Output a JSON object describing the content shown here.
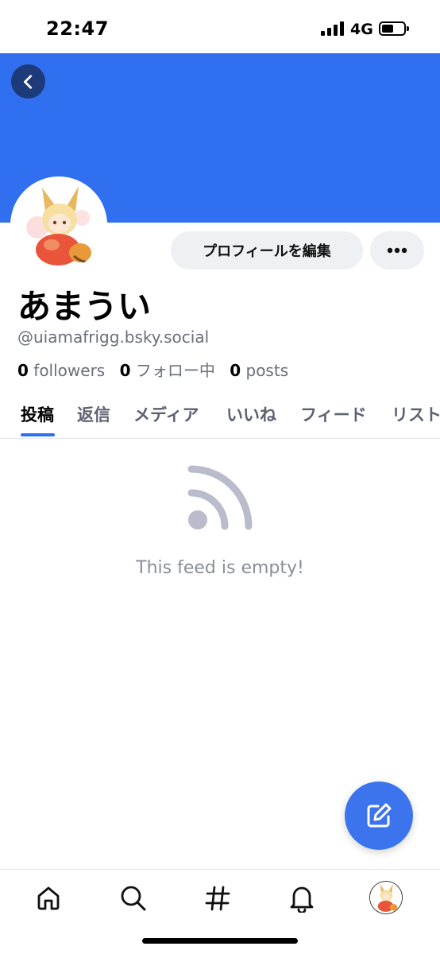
{
  "status_bar": {
    "time": "22:47",
    "network": "4G",
    "icons": [
      "signal-icon",
      "battery-icon"
    ]
  },
  "banner": {
    "color": "#3070f0",
    "back_icon": "chevron-left-icon"
  },
  "profile": {
    "avatar_icon": "fox-girl-avatar-icon",
    "edit_button_label": "プロフィールを編集",
    "more_icon": "ellipsis-icon",
    "display_name": "あまうい",
    "handle": "@uiamafrigg.bsky.social",
    "stats": {
      "followers_count": "0",
      "followers_label": "followers",
      "following_count": "0",
      "following_label": "フォロー中",
      "posts_count": "0",
      "posts_label": "posts"
    }
  },
  "tabs": [
    {
      "label": "投稿",
      "active": true
    },
    {
      "label": "返信",
      "active": false
    },
    {
      "label": "メディア",
      "active": false
    },
    {
      "label": "いいね",
      "active": false
    },
    {
      "label": "フィード",
      "active": false
    },
    {
      "label": "リスト",
      "active": false
    }
  ],
  "feed": {
    "empty_icon": "rss-feed-icon",
    "empty_text": "This feed is empty!"
  },
  "fab": {
    "icon": "compose-icon",
    "color": "#3c74ee"
  },
  "bottom_nav": {
    "items": [
      "home-icon",
      "search-icon",
      "hashtag-icon",
      "bell-icon",
      "profile-avatar"
    ]
  },
  "colors": {
    "accent": "#3070f0",
    "muted_text": "#6b6f7b",
    "empty_icon": "#b8bccb"
  }
}
